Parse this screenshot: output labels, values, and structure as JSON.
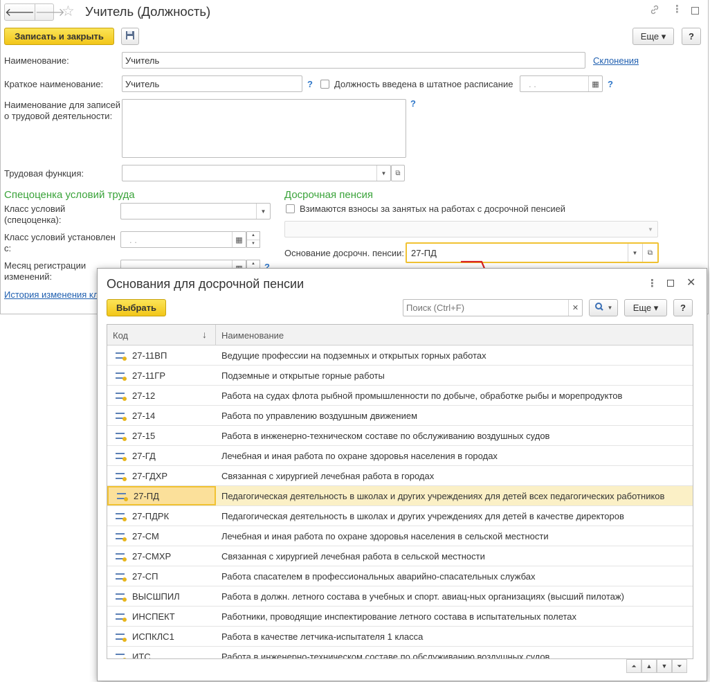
{
  "main": {
    "title": "Учитель (Должность)",
    "nav": {
      "back": "🡐",
      "forward": "🡒"
    },
    "toolbar": {
      "save_close": "Записать и закрыть",
      "more": "Еще ▾",
      "help": "?"
    },
    "naimenovanie": {
      "label": "Наименование:",
      "value": "Учитель",
      "link": "Склонения"
    },
    "kratkoe": {
      "label": "Краткое наименование:",
      "value": "Учитель",
      "help": "?",
      "checkbox_label": "Должность введена в штатное расписание",
      "date": ". .",
      "help2": "?"
    },
    "trud_zapis": {
      "label": "Наименование для записей о трудовой деятельности:",
      "help": "?"
    },
    "trud_func": {
      "label": "Трудовая функция:"
    },
    "specocenka": {
      "title": "Спецоценка условий труда",
      "class_label": "Класс условий (спецоценка):",
      "class_set_label": "Класс условий установлен с:",
      "class_set_date": ". .",
      "month_label": "Месяц регистрации изменений:",
      "month_help": "?",
      "history_link": "История изменения кл"
    },
    "pension": {
      "title": "Досрочная пенсия",
      "checkbox_label": "Взимаются взносы за занятых на работах с досрочной пенсией",
      "osnovanie_label": "Основание досрочн. пенсии:",
      "osnovanie_value": "27-ПД"
    }
  },
  "dialog": {
    "title": "Основания для досрочной пенсии",
    "select_button": "Выбрать",
    "search_placeholder": "Поиск (Ctrl+F)",
    "more": "Еще ▾",
    "help": "?",
    "columns": {
      "code": "Код",
      "name": "Наименование",
      "sort": "↓"
    },
    "rows": [
      {
        "code": "27-11ВП",
        "name": "Ведущие профессии на подземных и открытых горных работах"
      },
      {
        "code": "27-11ГР",
        "name": "Подземные и открытые горные работы"
      },
      {
        "code": "27-12",
        "name": "Работа на судах флота рыбной промышленности по добыче, обработке рыбы и морепродуктов"
      },
      {
        "code": "27-14",
        "name": "Работа по управлению воздушным движением"
      },
      {
        "code": "27-15",
        "name": "Работа в инженерно-техническом составе по обслуживанию воздушных судов"
      },
      {
        "code": "27-ГД",
        "name": "Лечебная и иная работа по охране здоровья населения в городах"
      },
      {
        "code": "27-ГДХР",
        "name": "Связанная с хирургией лечебная работа в городах"
      },
      {
        "code": "27-ПД",
        "name": "Педагогическая деятельность в школах и других учреждениях для детей всех педагогических работников"
      },
      {
        "code": "27-ПДРК",
        "name": "Педагогическая деятельность в школах и других учреждениях для детей в качестве директоров"
      },
      {
        "code": "27-СМ",
        "name": "Лечебная и иная работа по охране здоровья населения в сельской местности"
      },
      {
        "code": "27-СМХР",
        "name": "Связанная с хирургией лечебная работа в сельской местности"
      },
      {
        "code": "27-СП",
        "name": "Работа спасателем в профессиональных аварийно-спасательных службах"
      },
      {
        "code": "ВЫСШПИЛ",
        "name": "Работа в должн. летного состава в учебных и спорт. авиац-ных организациях (высший пилотаж)"
      },
      {
        "code": "ИНСПЕКТ",
        "name": "Работники, проводящие инспектирование летного состава в испытательных полетах"
      },
      {
        "code": "ИСПКЛС1",
        "name": "Работа в качестве летчика-испытателя 1 класса"
      },
      {
        "code": "ИТС",
        "name": "Работа в инженерно-техническом составе по обслуживанию воздушных судов"
      }
    ],
    "selected_index": 7
  }
}
